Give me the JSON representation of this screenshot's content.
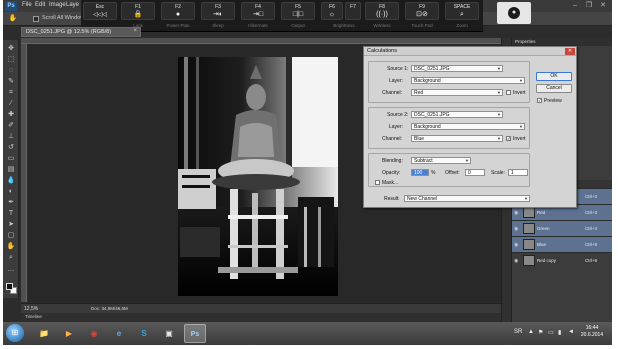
{
  "menubar": {
    "logo": "Ps",
    "items": [
      "File",
      "Edit",
      "Image",
      "Laye"
    ]
  },
  "options_bar": {
    "scroll_all_label": "Scroll All Windows"
  },
  "fkeys": [
    {
      "key": "Esc",
      "icon": "◁◁◁",
      "caption": ""
    },
    {
      "key": "F1",
      "icon": "🔒",
      "caption": "Lock"
    },
    {
      "key": "F2",
      "icon": "●",
      "caption": "Power Plan"
    },
    {
      "key": "F3",
      "icon": "⇥◐",
      "caption": "Sleep"
    },
    {
      "key": "F4",
      "icon": "⇥□",
      "caption": "Hibernate"
    },
    {
      "key": "F5",
      "icon": "□|□",
      "caption": "Output"
    },
    {
      "key": "F6",
      "icon": "☼",
      "caption": "Brightness"
    },
    {
      "key": "F7",
      "icon": "",
      "caption": ""
    },
    {
      "key": "F8",
      "icon": "((·))",
      "caption": "Wireless"
    },
    {
      "key": "F9",
      "icon": "⊡⊘",
      "caption": "Touch Pad"
    },
    {
      "key": "SPACE",
      "icon": "⌕",
      "caption": "Zoom"
    }
  ],
  "document": {
    "tab_title": "DSC_0251.JPG @ 12.5% (RGB/8)",
    "zoom": "12,5%",
    "doc_info": "Doc: 34,9M/46,6M",
    "timeline_label": "Timeline"
  },
  "right_panel": {
    "tab": "Properties",
    "layers": [
      {
        "name": "RGB",
        "shortcut": "Ctrl+2",
        "selected": true
      },
      {
        "name": "Red",
        "shortcut": "Ctrl+3",
        "selected": true
      },
      {
        "name": "Green",
        "shortcut": "Ctrl+4",
        "selected": true
      },
      {
        "name": "Blue",
        "shortcut": "Ctrl+5",
        "selected": true
      },
      {
        "name": "Red copy",
        "shortcut": "Ctrl+6",
        "selected": false
      }
    ]
  },
  "dialog": {
    "title": "Calculations",
    "source1": {
      "label": "Source 1:",
      "file": "DSC_0251.JPG",
      "layer_label": "Layer:",
      "layer": "Background",
      "channel_label": "Channel:",
      "channel": "Red",
      "invert_label": "Invert",
      "invert_checked": false
    },
    "source2": {
      "label": "Source 2:",
      "file": "DSC_0251.JPG",
      "layer_label": "Layer:",
      "layer": "Background",
      "channel_label": "Channel:",
      "channel": "Blue",
      "invert_label": "Invert",
      "invert_checked": true
    },
    "blending": {
      "label": "Blending:",
      "mode": "Subtract",
      "opacity_label": "Opacity:",
      "opacity": "100",
      "percent": "%",
      "offset_label": "Offset:",
      "offset": "0",
      "scale_label": "Scale:",
      "scale": "1",
      "mask_label": "Mask..."
    },
    "result_label": "Result:",
    "result": "New Channel",
    "ok": "OK",
    "cancel": "Cancel",
    "preview_label": "Preview",
    "preview_checked": true
  },
  "taskbar": {
    "apps": [
      "📁",
      "▶",
      "◉",
      "e",
      "S",
      "▣",
      "Ps"
    ],
    "language": "SR",
    "time": "16:44",
    "date": "20.6.2014"
  },
  "colors": {
    "selection": "#5d7291",
    "dialog_bg": "#d4d4d4",
    "highlight": "#4a7fd6"
  }
}
